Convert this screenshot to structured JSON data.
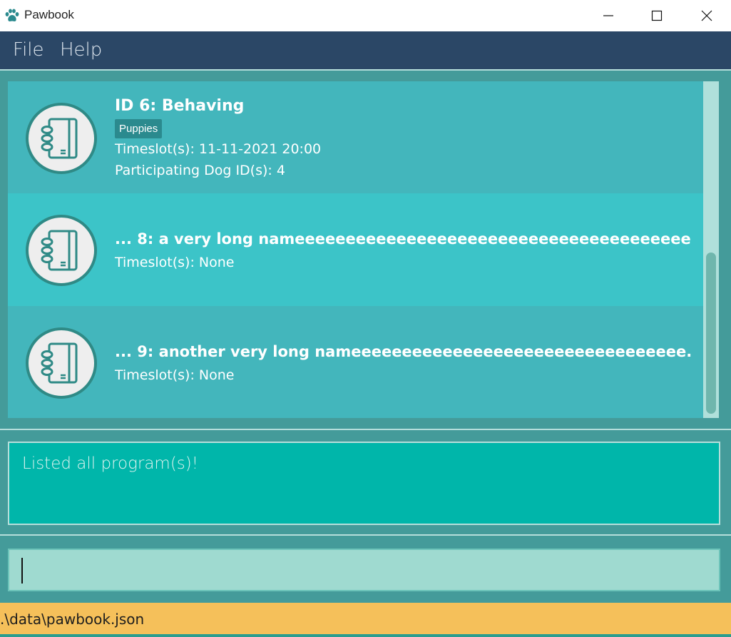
{
  "window": {
    "title": "Pawbook",
    "app_icon": "paw-icon",
    "controls": [
      "minimize-icon",
      "maximize-icon",
      "close-icon"
    ]
  },
  "menu": {
    "file_label": "File",
    "help_label": "Help"
  },
  "programs": [
    {
      "title": "ID 6:  Behaving",
      "tag": "Puppies",
      "timeslot": "Timeslot(s): 11-11-2021 20:00",
      "dogs": "Participating Dog ID(s): 4",
      "icon": "notebook-icon"
    },
    {
      "title": "... 8:  a very long nameeeeeeeeeeeeeeeeeeeeeeeeeeeeeeeeeeeeeee...",
      "timeslot": "Timeslot(s): None",
      "icon": "notebook-icon"
    },
    {
      "title": "... 9:  another very long nameeeeeeeeeeeeeeeeeeeeeeeeeeeeeeeee...",
      "timeslot": "Timeslot(s): None",
      "icon": "notebook-icon"
    }
  ],
  "result": {
    "message": "Listed all program(s)!"
  },
  "command": {
    "value": ""
  },
  "status": {
    "file_path": ".\\data\\pawbook.json"
  },
  "colors": {
    "menu_bg": "#2b4766",
    "list_bg": "#449b9a",
    "card_bg": "#43b6bc",
    "card_bg_alt": "#3cc4c8",
    "result_bg": "#00b6aa",
    "command_bg": "#9fdad0",
    "status_bg": "#f5c05a"
  }
}
